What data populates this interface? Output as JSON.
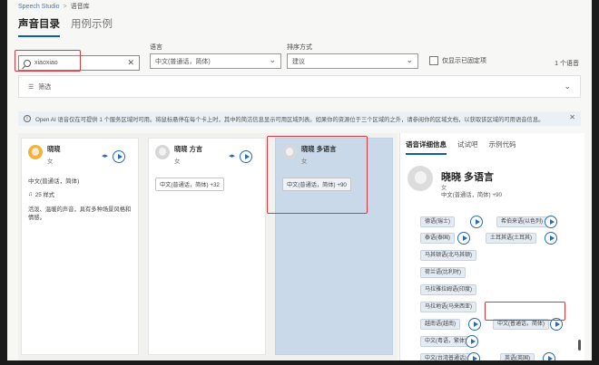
{
  "breadcrumb": {
    "root": "Speech Studio",
    "separator": ">",
    "current": "语音库"
  },
  "tabs": [
    {
      "label": "声音目录",
      "active": true
    },
    {
      "label": "用例示例",
      "active": false
    }
  ],
  "filters": {
    "search_value": "xiaoxiao",
    "language_label": "语言",
    "language_value": "中文(普通话，简体)",
    "sort_label": "排序方式",
    "sort_value": "建议",
    "checkbox_label": "仅显示已固定项",
    "count": "1 个语音",
    "filter_label": "筛选"
  },
  "info_bar": {
    "text": "Open AI 语音仅在可提供 1 个服务区域时可用。将鼠标悬停在每个卡上时，其中的简洁信息显示可用区域列表。如果你的资源位于三个区域的之外，请参阅你的区域文档，以获取该区域的可用语音信息。"
  },
  "cards": [
    {
      "name": "晓晓",
      "sub": "女",
      "lang": "中文(普通话，简体)",
      "styles": "25 样式",
      "desc": "活泼、温暖的声音，具有多种场景风格和情感。"
    },
    {
      "name": "晓晓 方言",
      "sub": "女",
      "chip": "中文(普通话，简体) +32"
    },
    {
      "name": "晓晓 多语言",
      "sub": "女",
      "chip": "中文(普通话，简体) +90"
    }
  ],
  "panel": {
    "tabs": [
      "语音详细信息",
      "试试吧",
      "示例代码"
    ],
    "voice_name": "晓晓 多语言",
    "voice_sub": "女",
    "voice_lang": "中文(普通话，简体) +90",
    "chips": [
      "德语(瑞士)",
      "泰语(泰国)",
      "马其顿语(北马其顿)",
      "荷兰语(比利时)",
      "马拉雅拉姆语(印度)",
      "马拉地语(马来西亚)",
      "越南语(越南)",
      "中文(普通话，简体)",
      "中文(粤语，繁体)",
      "中文(台湾普通话)",
      "英语(英国)"
    ],
    "chips_right": [
      "希伯来语(以色列)",
      "土耳其语(土耳其)"
    ]
  },
  "colors": {
    "accent": "#0b5fad",
    "annotation_red": "#d9383f",
    "selected_card": "#c9d9ea"
  }
}
